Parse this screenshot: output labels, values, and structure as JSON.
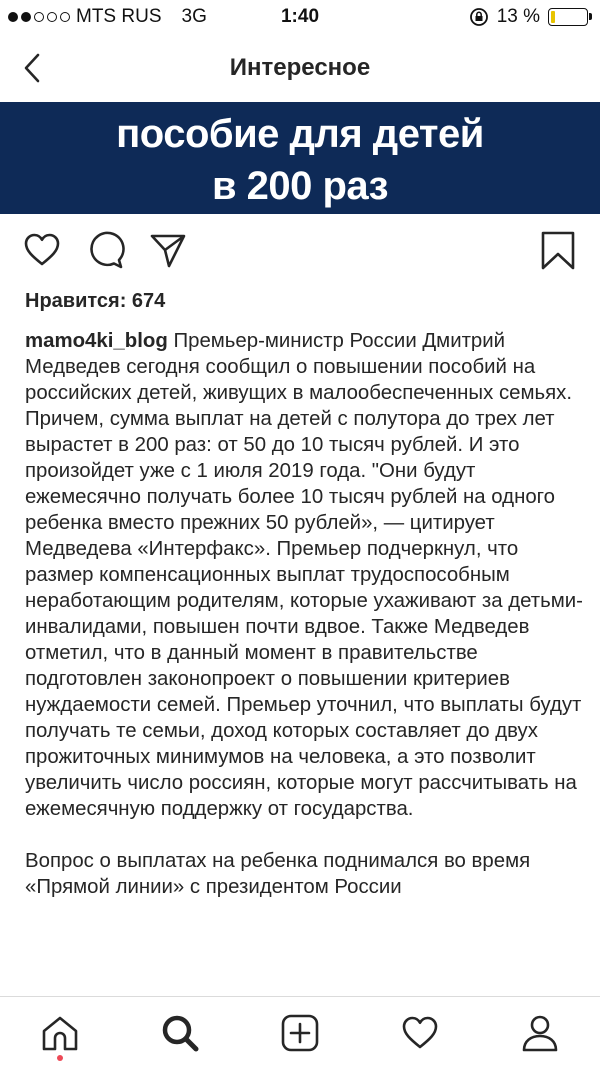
{
  "status_bar": {
    "carrier": "MTS RUS",
    "network": "3G",
    "time": "1:40",
    "battery_text": "13 %",
    "battery_level": 0.13,
    "battery_color": "#e8c400"
  },
  "nav": {
    "title": "Интересное",
    "back_icon": "chevron-left-icon"
  },
  "banner": {
    "line1": "пособие для детей",
    "line2": "в 200 раз",
    "background": "#0e2a57"
  },
  "actions": {
    "icons": [
      "heart-icon",
      "comment-icon",
      "share-icon",
      "bookmark-icon"
    ]
  },
  "post": {
    "likes": "Нравится: 674",
    "username": "mamo4ki_blog",
    "caption_p1": " Премьер-министр России Дмитрий Медведев сегодня сообщил о повышении пособий на российских детей, живущих в малообеспеченных семьях. Причем, сумма выплат на детей с полутора до трех лет вырастет в 200 раз: от 50 до 10 тысяч  рублей. И это произойдет уже с 1 июля 2019 года. \"Они будут ежемесячно получать более 10 тысяч рублей на одного ребенка вместо прежних 50 рублей», — цитирует Медведева «Интерфакс». Премьер подчеркнул, что размер компенсационных выплат трудоспособным неработающим родителям, которые ухаживают за детьми-инвалидами, повышен почти вдвое. Также Медведев отметил, что в данный момент в правительстве подготовлен законопроект о повышении критериев нуждаемости семей. Премьер уточнил, что выплаты будут получать те семьи, доход которых составляет до двух прожиточных минимумов на человека, а это позволит увеличить число россиян, которые могут рассчитывать на ежемесячную поддержку от государства.",
    "caption_p2": "Вопрос о выплатах на ребенка поднимался во время «Прямой линии» с президентом России"
  },
  "tab_bar": {
    "tabs": [
      "home-icon",
      "search-icon",
      "add-post-icon",
      "activity-heart-icon",
      "profile-icon"
    ],
    "notification_color": "#ed4956"
  }
}
